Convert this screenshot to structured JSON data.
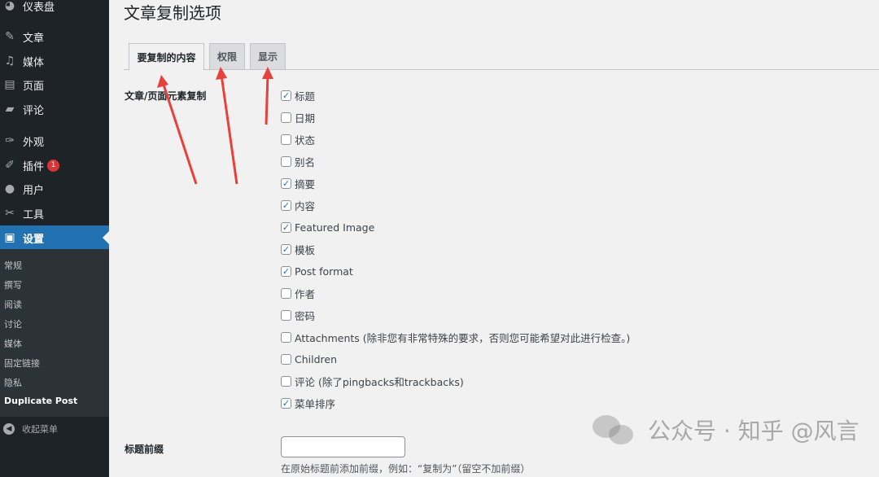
{
  "sidebar": {
    "items": [
      {
        "label": "仪表盘",
        "icon": "dashboard-icon",
        "glyph": "◕"
      },
      {
        "label": "文章",
        "icon": "pin-icon",
        "glyph": "✎"
      },
      {
        "label": "媒体",
        "icon": "media-icon",
        "glyph": "♫"
      },
      {
        "label": "页面",
        "icon": "page-icon",
        "glyph": "▤"
      },
      {
        "label": "评论",
        "icon": "comment-icon",
        "glyph": "▰"
      },
      {
        "label": "外观",
        "icon": "brush-icon",
        "glyph": "✑"
      },
      {
        "label": "插件",
        "icon": "plugin-icon",
        "glyph": "✐",
        "badge": "1"
      },
      {
        "label": "用户",
        "icon": "user-icon",
        "glyph": "●"
      },
      {
        "label": "工具",
        "icon": "wrench-icon",
        "glyph": "✂"
      },
      {
        "label": "设置",
        "icon": "settings-icon",
        "glyph": "▣"
      }
    ],
    "submenu": [
      "常规",
      "撰写",
      "阅读",
      "讨论",
      "媒体",
      "固定链接",
      "隐私",
      "Duplicate Post"
    ],
    "collapse_label": "收起菜单",
    "collapse_glyph": "◀"
  },
  "page": {
    "title": "文章复制选项"
  },
  "tabs": [
    {
      "label": "要复制的内容",
      "active": true
    },
    {
      "label": "权限",
      "active": false
    },
    {
      "label": "显示",
      "active": false
    }
  ],
  "elements_section": {
    "label": "文章/页面元素复制",
    "options": [
      {
        "label": "标题",
        "checked": true
      },
      {
        "label": "日期",
        "checked": false
      },
      {
        "label": "状态",
        "checked": false
      },
      {
        "label": "别名",
        "checked": false
      },
      {
        "label": "摘要",
        "checked": true
      },
      {
        "label": "内容",
        "checked": true
      },
      {
        "label": "Featured Image",
        "checked": true
      },
      {
        "label": "模板",
        "checked": true
      },
      {
        "label": "Post format",
        "checked": true
      },
      {
        "label": "作者",
        "checked": false
      },
      {
        "label": "密码",
        "checked": false
      },
      {
        "label": "Attachments (除非您有非常特殊的要求，否则您可能希望对此进行检查。)",
        "checked": false
      },
      {
        "label": "Children",
        "checked": false
      },
      {
        "label": "评论 (除了pingbacks和trackbacks)",
        "checked": false
      },
      {
        "label": "菜单排序",
        "checked": true
      }
    ]
  },
  "prefix_section": {
    "label": "标题前缀",
    "value": "",
    "description": "在原始标题前添加前缀，例如：“复制为”（留空不加前缀）"
  },
  "watermark": {
    "text": "公众号 · 知乎 @风言"
  },
  "colors": {
    "accent": "#2271b1",
    "sidebar": "#1d2327",
    "arrow": "#e8413c"
  }
}
